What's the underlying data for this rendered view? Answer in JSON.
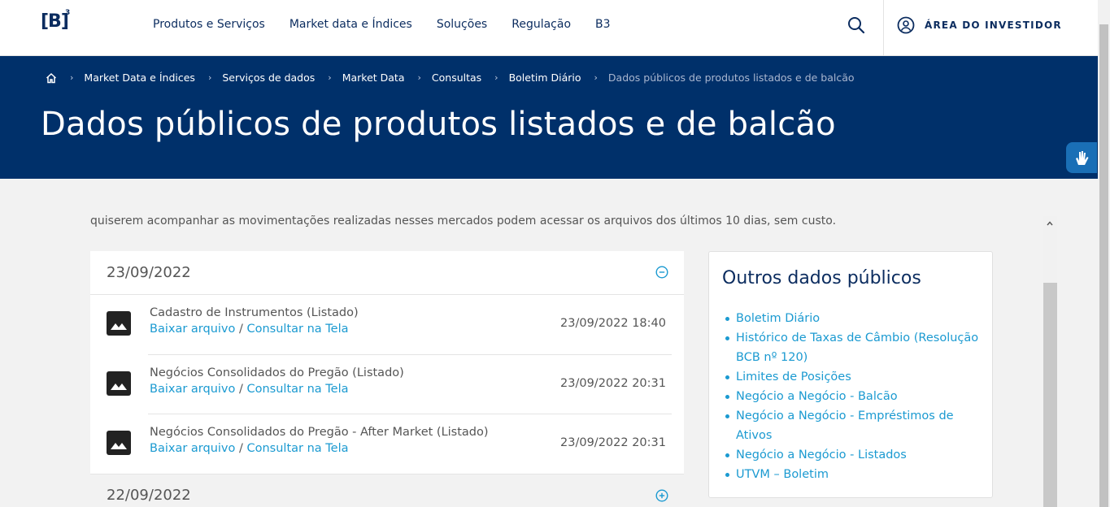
{
  "header": {
    "logo_text": "[B]",
    "logo_sup": "3",
    "nav": [
      "Produtos e Serviços",
      "Market data e Índices",
      "Soluções",
      "Regulação",
      "B3"
    ],
    "investor_label": "ÁREA DO INVESTIDOR"
  },
  "breadcrumb": {
    "items": [
      "Market Data e Índices",
      "Serviços de dados",
      "Market Data",
      "Consultas",
      "Boletim Diário"
    ],
    "current": "Dados públicos de produtos listados e de balcão"
  },
  "page_title": "Dados públicos de produtos listados e de balcão",
  "intro_text": "quiserem acompanhar as movimentações realizadas nesses mercados podem acessar os arquivos dos últimos 10 dias, sem custo.",
  "accordion": [
    {
      "date": "23/09/2022",
      "expanded": true,
      "files": [
        {
          "name": "Cadastro de Instrumentos (Listado)",
          "download": "Baixar arquivo",
          "separator": "/",
          "view": "Consultar na Tela",
          "timestamp": "23/09/2022 18:40"
        },
        {
          "name": "Negócios Consolidados do Pregão (Listado)",
          "download": "Baixar arquivo",
          "separator": "/",
          "view": "Consultar na Tela",
          "timestamp": "23/09/2022 20:31"
        },
        {
          "name": "Negócios Consolidados do Pregão - After Market (Listado)",
          "download": "Baixar arquivo",
          "separator": "/",
          "view": "Consultar na Tela",
          "timestamp": "23/09/2022 20:31"
        }
      ]
    },
    {
      "date": "22/09/2022",
      "expanded": false
    }
  ],
  "sidebar": {
    "title": "Outros dados públicos",
    "links": [
      "Boletim Diário",
      "Histórico de Taxas de Câmbio (Resolução BCB nº 120)",
      "Limites de Posições",
      "Negócio a Negócio - Balcão",
      "Negócio a Negócio - Empréstimos de Ativos",
      "Negócio a Negócio - Listados",
      "UTVM – Boletim"
    ]
  },
  "colors": {
    "navy": "#00306a",
    "brand_text": "#0b2c5f",
    "link": "#1b9ad1",
    "background": "#f2f2f2"
  },
  "icons": [
    "home-icon",
    "chevron-right-icon",
    "search-icon",
    "user-circle-icon",
    "image-file-icon",
    "collapse-minus-icon",
    "expand-plus-icon",
    "sign-language-icon",
    "scroll-up-arrow-icon"
  ]
}
